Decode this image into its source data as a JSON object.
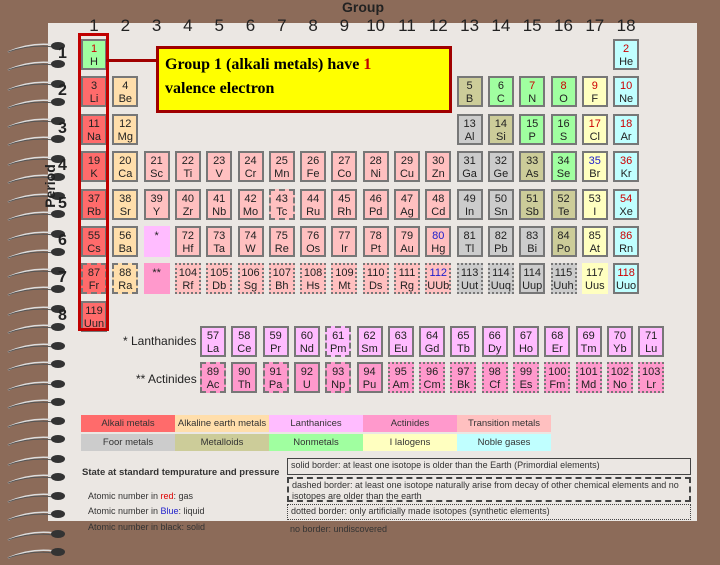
{
  "title": "Group",
  "period_label": "Period",
  "groups": [
    "1",
    "2",
    "3",
    "4",
    "5",
    "6",
    "7",
    "8",
    "9",
    "10",
    "11",
    "12",
    "13",
    "14",
    "15",
    "16",
    "17",
    "18"
  ],
  "periods": [
    "1",
    "2",
    "3",
    "4",
    "5",
    "6",
    "7",
    "8"
  ],
  "callout": {
    "text": "Group 1 (alkali metals) have ",
    "highlight": "1",
    "text2": "valence electron"
  },
  "colors": {
    "alkali": "#ff6b6b",
    "alkaline": "#ffdeab",
    "lanthanide": "#ffbcff",
    "actinide": "#ff99cc",
    "transition": "#ffc0c0",
    "poor": "#cccccc",
    "metalloid": "#cccc99",
    "nonmetal": "#a0ffa0",
    "halogen": "#ffffc0",
    "noble": "#c0ffff",
    "gas": "#cc0000",
    "liquid": "#2020cc",
    "solid": "#222222",
    "accent": "#c00000",
    "callout_bg": "#ffff00"
  },
  "elements": [
    [
      1,
      "H",
      "nonmetal",
      1,
      1,
      "gas",
      "solid"
    ],
    [
      2,
      "He",
      "noble",
      18,
      1,
      "gas",
      "solid"
    ],
    [
      3,
      "Li",
      "alkali",
      1,
      2,
      "solid",
      "solid"
    ],
    [
      4,
      "Be",
      "alkaline",
      2,
      2,
      "solid",
      "solid"
    ],
    [
      5,
      "B",
      "metalloid",
      13,
      2,
      "solid",
      "solid"
    ],
    [
      6,
      "C",
      "nonmetal",
      14,
      2,
      "solid",
      "solid"
    ],
    [
      7,
      "N",
      "nonmetal",
      15,
      2,
      "gas",
      "solid"
    ],
    [
      8,
      "O",
      "nonmetal",
      16,
      2,
      "gas",
      "solid"
    ],
    [
      9,
      "F",
      "halogen",
      17,
      2,
      "gas",
      "solid"
    ],
    [
      10,
      "Ne",
      "noble",
      18,
      2,
      "gas",
      "solid"
    ],
    [
      11,
      "Na",
      "alkali",
      1,
      3,
      "solid",
      "solid"
    ],
    [
      12,
      "Mg",
      "alkaline",
      2,
      3,
      "solid",
      "solid"
    ],
    [
      13,
      "Al",
      "poor",
      13,
      3,
      "solid",
      "solid"
    ],
    [
      14,
      "Si",
      "metalloid",
      14,
      3,
      "solid",
      "solid"
    ],
    [
      15,
      "P",
      "nonmetal",
      15,
      3,
      "solid",
      "solid"
    ],
    [
      16,
      "S",
      "nonmetal",
      16,
      3,
      "solid",
      "solid"
    ],
    [
      17,
      "Cl",
      "halogen",
      17,
      3,
      "gas",
      "solid"
    ],
    [
      18,
      "Ar",
      "noble",
      18,
      3,
      "gas",
      "solid"
    ],
    [
      19,
      "K",
      "alkali",
      1,
      4,
      "solid",
      "solid"
    ],
    [
      20,
      "Ca",
      "alkaline",
      2,
      4,
      "solid",
      "solid"
    ],
    [
      21,
      "Sc",
      "transition",
      3,
      4,
      "solid",
      "solid"
    ],
    [
      22,
      "Ti",
      "transition",
      4,
      4,
      "solid",
      "solid"
    ],
    [
      23,
      "V",
      "transition",
      5,
      4,
      "solid",
      "solid"
    ],
    [
      24,
      "Cr",
      "transition",
      6,
      4,
      "solid",
      "solid"
    ],
    [
      25,
      "Mn",
      "transition",
      7,
      4,
      "solid",
      "solid"
    ],
    [
      26,
      "Fe",
      "transition",
      8,
      4,
      "solid",
      "solid"
    ],
    [
      27,
      "Co",
      "transition",
      9,
      4,
      "solid",
      "solid"
    ],
    [
      28,
      "Ni",
      "transition",
      10,
      4,
      "solid",
      "solid"
    ],
    [
      29,
      "Cu",
      "transition",
      11,
      4,
      "solid",
      "solid"
    ],
    [
      30,
      "Zn",
      "transition",
      12,
      4,
      "solid",
      "solid"
    ],
    [
      31,
      "Ga",
      "poor",
      13,
      4,
      "solid",
      "solid"
    ],
    [
      32,
      "Ge",
      "poor",
      14,
      4,
      "solid",
      "solid"
    ],
    [
      33,
      "As",
      "metalloid",
      15,
      4,
      "solid",
      "solid"
    ],
    [
      34,
      "Se",
      "nonmetal",
      16,
      4,
      "solid",
      "solid"
    ],
    [
      35,
      "Br",
      "halogen",
      17,
      4,
      "liquid",
      "solid"
    ],
    [
      36,
      "Kr",
      "noble",
      18,
      4,
      "gas",
      "solid"
    ],
    [
      37,
      "Rb",
      "alkali",
      1,
      5,
      "solid",
      "solid"
    ],
    [
      38,
      "Sr",
      "alkaline",
      2,
      5,
      "solid",
      "solid"
    ],
    [
      39,
      "Y",
      "transition",
      3,
      5,
      "solid",
      "solid"
    ],
    [
      40,
      "Zr",
      "transition",
      4,
      5,
      "solid",
      "solid"
    ],
    [
      41,
      "Nb",
      "transition",
      5,
      5,
      "solid",
      "solid"
    ],
    [
      42,
      "Mo",
      "transition",
      6,
      5,
      "solid",
      "solid"
    ],
    [
      43,
      "Tc",
      "transition",
      7,
      5,
      "solid",
      "dashed"
    ],
    [
      44,
      "Ru",
      "transition",
      8,
      5,
      "solid",
      "solid"
    ],
    [
      45,
      "Rh",
      "transition",
      9,
      5,
      "solid",
      "solid"
    ],
    [
      46,
      "Pd",
      "transition",
      10,
      5,
      "solid",
      "solid"
    ],
    [
      47,
      "Ag",
      "transition",
      11,
      5,
      "solid",
      "solid"
    ],
    [
      48,
      "Cd",
      "transition",
      12,
      5,
      "solid",
      "solid"
    ],
    [
      49,
      "In",
      "poor",
      13,
      5,
      "solid",
      "solid"
    ],
    [
      50,
      "Sn",
      "poor",
      14,
      5,
      "solid",
      "solid"
    ],
    [
      51,
      "Sb",
      "metalloid",
      15,
      5,
      "solid",
      "solid"
    ],
    [
      52,
      "Te",
      "metalloid",
      16,
      5,
      "solid",
      "solid"
    ],
    [
      53,
      "I",
      "halogen",
      17,
      5,
      "solid",
      "solid"
    ],
    [
      54,
      "Xe",
      "noble",
      18,
      5,
      "gas",
      "solid"
    ],
    [
      55,
      "Cs",
      "alkali",
      1,
      6,
      "solid",
      "solid"
    ],
    [
      56,
      "Ba",
      "alkaline",
      2,
      6,
      "solid",
      "solid"
    ],
    [
      "*",
      "",
      "lanthanide",
      3,
      6,
      "solid",
      "none"
    ],
    [
      72,
      "Hf",
      "transition",
      4,
      6,
      "solid",
      "solid"
    ],
    [
      73,
      "Ta",
      "transition",
      5,
      6,
      "solid",
      "solid"
    ],
    [
      74,
      "W",
      "transition",
      6,
      6,
      "solid",
      "solid"
    ],
    [
      75,
      "Re",
      "transition",
      7,
      6,
      "solid",
      "solid"
    ],
    [
      76,
      "Os",
      "transition",
      8,
      6,
      "solid",
      "solid"
    ],
    [
      77,
      "Ir",
      "transition",
      9,
      6,
      "solid",
      "solid"
    ],
    [
      78,
      "Pt",
      "transition",
      10,
      6,
      "solid",
      "solid"
    ],
    [
      79,
      "Au",
      "transition",
      11,
      6,
      "solid",
      "solid"
    ],
    [
      80,
      "Hg",
      "transition",
      12,
      6,
      "liquid",
      "solid"
    ],
    [
      81,
      "Tl",
      "poor",
      13,
      6,
      "solid",
      "solid"
    ],
    [
      82,
      "Pb",
      "poor",
      14,
      6,
      "solid",
      "solid"
    ],
    [
      83,
      "Bi",
      "poor",
      15,
      6,
      "solid",
      "solid"
    ],
    [
      84,
      "Po",
      "metalloid",
      16,
      6,
      "solid",
      "solid"
    ],
    [
      85,
      "At",
      "halogen",
      17,
      6,
      "solid",
      "solid"
    ],
    [
      86,
      "Rn",
      "noble",
      18,
      6,
      "gas",
      "solid"
    ],
    [
      87,
      "Fr",
      "alkali",
      1,
      7,
      "solid",
      "dashed"
    ],
    [
      88,
      "Ra",
      "alkaline",
      2,
      7,
      "solid",
      "dashed"
    ],
    [
      "**",
      "",
      "actinide",
      3,
      7,
      "solid",
      "none"
    ],
    [
      104,
      "Rf",
      "transition",
      4,
      7,
      "solid",
      "dotted"
    ],
    [
      105,
      "Db",
      "transition",
      5,
      7,
      "solid",
      "dotted"
    ],
    [
      106,
      "Sg",
      "transition",
      6,
      7,
      "solid",
      "dotted"
    ],
    [
      107,
      "Bh",
      "transition",
      7,
      7,
      "solid",
      "dotted"
    ],
    [
      108,
      "Hs",
      "transition",
      8,
      7,
      "solid",
      "dotted"
    ],
    [
      109,
      "Mt",
      "transition",
      9,
      7,
      "solid",
      "dotted"
    ],
    [
      110,
      "Ds",
      "transition",
      10,
      7,
      "solid",
      "dotted"
    ],
    [
      111,
      "Rg",
      "transition",
      11,
      7,
      "solid",
      "dotted"
    ],
    [
      112,
      "UUb",
      "transition",
      12,
      7,
      "liquid",
      "dotted"
    ],
    [
      113,
      "Uut",
      "poor",
      13,
      7,
      "solid",
      "dotted"
    ],
    [
      114,
      "Uuq",
      "poor",
      14,
      7,
      "solid",
      "dotted"
    ],
    [
      114,
      "Uup",
      "poor",
      15,
      7,
      "solid",
      "solid"
    ],
    [
      115,
      "Uuh",
      "poor",
      16,
      7,
      "solid",
      "dotted"
    ],
    [
      117,
      "Uus",
      "halogen",
      17,
      7,
      "solid",
      "none"
    ],
    [
      118,
      "Uuo",
      "noble",
      18,
      7,
      "gas",
      "solid"
    ],
    [
      119,
      "Uun",
      "alkali",
      1,
      8,
      "solid",
      "solid"
    ]
  ],
  "series_labels": {
    "lanthanides": "* Lanthanides",
    "actinides": "** Actinides"
  },
  "lanthanides": [
    [
      57,
      "La",
      "solid"
    ],
    [
      58,
      "Ce",
      "solid"
    ],
    [
      59,
      "Pr",
      "solid"
    ],
    [
      60,
      "Nd",
      "solid"
    ],
    [
      61,
      "Pm",
      "dashed"
    ],
    [
      62,
      "Sm",
      "solid"
    ],
    [
      63,
      "Eu",
      "solid"
    ],
    [
      64,
      "Gd",
      "solid"
    ],
    [
      65,
      "Tb",
      "solid"
    ],
    [
      66,
      "Dy",
      "solid"
    ],
    [
      67,
      "Ho",
      "solid"
    ],
    [
      68,
      "Er",
      "solid"
    ],
    [
      69,
      "Tm",
      "solid"
    ],
    [
      70,
      "Yb",
      "solid"
    ],
    [
      71,
      "Lu",
      "solid"
    ]
  ],
  "actinides": [
    [
      89,
      "Ac",
      "dashed"
    ],
    [
      90,
      "Th",
      "solid"
    ],
    [
      91,
      "Pa",
      "dashed"
    ],
    [
      92,
      "U",
      "solid"
    ],
    [
      93,
      "Np",
      "dashed"
    ],
    [
      94,
      "Pu",
      "solid"
    ],
    [
      95,
      "Am",
      "dotted"
    ],
    [
      96,
      "Cm",
      "dotted"
    ],
    [
      97,
      "Bk",
      "dotted"
    ],
    [
      98,
      "Cf",
      "dotted"
    ],
    [
      99,
      "Es",
      "dotted"
    ],
    [
      100,
      "Fm",
      "dotted"
    ],
    [
      101,
      "Md",
      "dotted"
    ],
    [
      102,
      "No",
      "dotted"
    ],
    [
      103,
      "Lr",
      "dotted"
    ]
  ],
  "legend": [
    [
      "Alkali metals",
      "alkali"
    ],
    [
      "Alkaline earth metals",
      "alkaline"
    ],
    [
      "Lanthanices",
      "lanthanide"
    ],
    [
      "Actinides",
      "actinide"
    ],
    [
      "Transition metals",
      "transition"
    ],
    [
      "Foor metals",
      "poor"
    ],
    [
      "Metalloids",
      "metalloid"
    ],
    [
      "Nonmetals",
      "nonmetal"
    ],
    [
      "I lalogens",
      "halogen"
    ],
    [
      "Noble gases",
      "noble"
    ]
  ],
  "state": {
    "title": "State at standard tempurature and pressure",
    "red_pre": "Atomic number in ",
    "red_word": "red",
    "red_post": ": gas",
    "blue_pre": "Atomic number in ",
    "blue_word": "Blue",
    "blue_post": ": liquid",
    "black": "Atomic number in black: solid"
  },
  "borders": {
    "solid": "solid border: at least one isotope is older than the Earth (Primordial elements)",
    "dashed": "dashed border: at least one isotope naturally arise from decay of other chemical elements and no isotopes are older than the earth",
    "dotted": "dotted border: only artificially made isotopes (synthetic elements)",
    "none": "no border: undiscovered"
  }
}
